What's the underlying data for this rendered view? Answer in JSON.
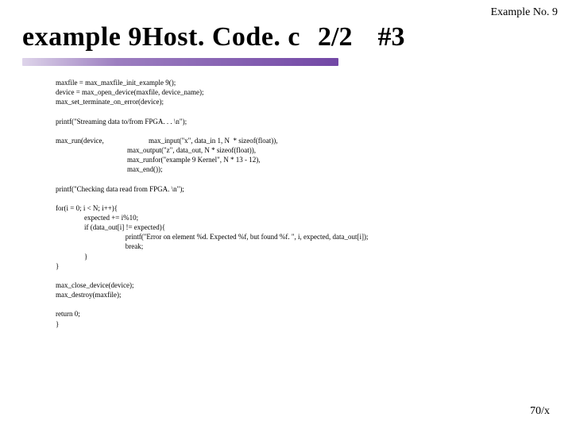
{
  "header": {
    "label": "Example No. 9"
  },
  "title": {
    "main": "example 9Host. Code. c",
    "page": "2/2",
    "hash": "#3"
  },
  "code": {
    "text": "maxfile = max_maxfile_init_example 9();\ndevice = max_open_device(maxfile, device_name);\nmax_set_terminate_on_error(device);\n\nprintf(\"Streaming data to/from FPGA. . . \\n\");\n\nmax_run(device,                         max_input(\"x\", data_in 1, N  * sizeof(float)),\n                                        max_output(\"z\", data_out, N * sizeof(float)),\n                                        max_runfor(\"example 9 Kernel\", N * 13 - 12),\n                                        max_end());\n\nprintf(\"Checking data read from FPGA. \\n\");\n\nfor(i = 0; i < N; i++){\n                expected += i%10;\n                if (data_out[i] != expected){\n                                       printf(\"Error on element %d. Expected %f, but found %f. \", i, expected, data_out[i]);\n                                       break;\n                }\n}\n\nmax_close_device(device);\nmax_destroy(maxfile);\n\nreturn 0;\n}"
  },
  "footer": {
    "page": "70/x"
  }
}
